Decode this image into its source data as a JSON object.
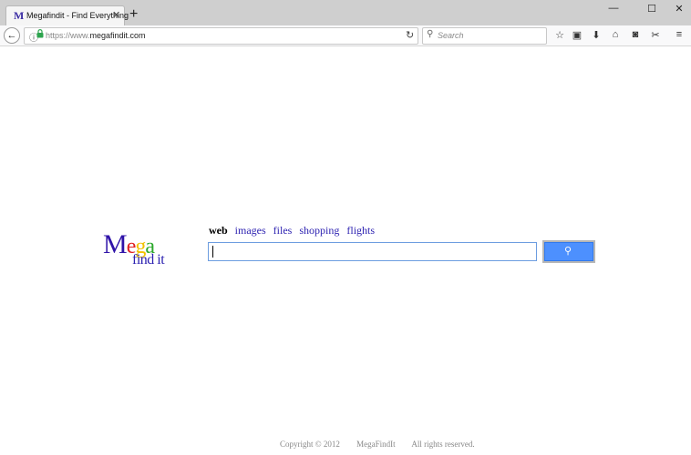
{
  "browser": {
    "tab": {
      "favicon": "M",
      "title": "Megafindit - Find Everything",
      "close": "✕"
    },
    "new_tab": "+",
    "window_controls": {
      "minimize": "—",
      "maximize": "☐",
      "close": "✕"
    },
    "url": {
      "scheme": "https://www.",
      "host": "megafindit.com"
    },
    "search_placeholder": "Search",
    "icons": [
      "back-arrow-icon",
      "info-icon",
      "lock-icon",
      "reload-icon",
      "search-icon",
      "bookmark-star-icon",
      "reading-list-icon",
      "download-icon",
      "home-icon",
      "pocket-icon",
      "screenshot-icon",
      "menu-icon"
    ],
    "glyphs": {
      "back": "←",
      "info": "ⓘ",
      "lock": "🔒",
      "reload": "↻",
      "search": "⚲",
      "star": "☆",
      "clipboard": "▣",
      "download": "⬇",
      "home": "⌂",
      "pocket": "◙",
      "screenshot": "✂",
      "menu": "≡"
    }
  },
  "logo": {
    "m": "M",
    "e": "e",
    "g": "g",
    "a": "a",
    "findit": "find it"
  },
  "search_tabs": {
    "web": "web",
    "images": "images",
    "files": "files",
    "shopping": "shopping",
    "flights": "flights"
  },
  "search": {
    "value": "",
    "button_glyph": "⚲"
  },
  "footer": {
    "copyright": "Copyright © 2012",
    "brand": "MegaFindIt",
    "rights": "All rights reserved."
  },
  "colors": {
    "accent": "#4d90fe",
    "link": "#2a1fb0"
  }
}
